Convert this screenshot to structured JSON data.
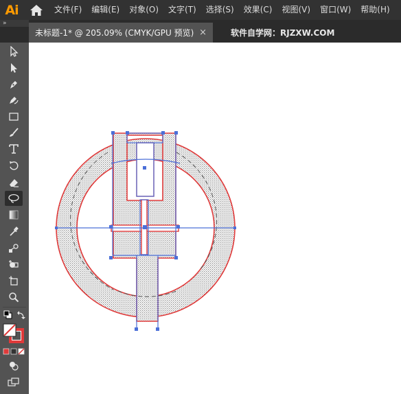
{
  "app": {
    "logo": "Ai"
  },
  "menubar": {
    "items": [
      {
        "label": "文件(F)"
      },
      {
        "label": "编辑(E)"
      },
      {
        "label": "对象(O)"
      },
      {
        "label": "文字(T)"
      },
      {
        "label": "选择(S)"
      },
      {
        "label": "效果(C)"
      },
      {
        "label": "视图(V)"
      },
      {
        "label": "窗口(W)"
      },
      {
        "label": "帮助(H)"
      }
    ]
  },
  "tabs": {
    "collapse_glyph": "»",
    "active": {
      "title": "未标题-1* @ 205.09% (CMYK/GPU 预览)",
      "close": "×"
    },
    "secondary": {
      "title": "软件自学网：RJZXW.COM"
    }
  },
  "tools": {
    "icons": [
      "selection-icon",
      "direct-selection-icon",
      "pen-icon",
      "curvature-icon",
      "rectangle-icon",
      "paintbrush-icon",
      "type-icon",
      "rotate-icon",
      "eraser-icon",
      "lasso-icon",
      "gradient-icon",
      "eyedropper-icon",
      "blend-icon",
      "shape-builder-icon",
      "artboard-icon",
      "zoom-icon",
      "default-colors-icon",
      "swap-colors-icon",
      "fill-stroke-icon",
      "color-mode-icon",
      "draw-mode-icon",
      "screen-mode-icon"
    ]
  },
  "colors": {
    "stroke": "#e03a3a",
    "selection": "#4b6fd8",
    "pattern": "#8a8a8a",
    "canvas": "#ffffff",
    "ui_dark": "#323232",
    "ui_mid": "#535353",
    "logo": "#ff9a00"
  }
}
